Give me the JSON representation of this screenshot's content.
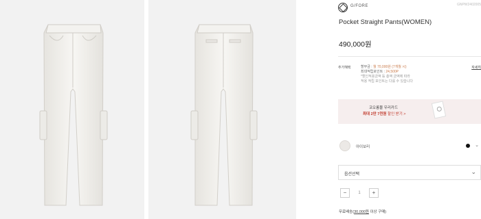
{
  "gallery": {
    "images": [
      {
        "alt": "front-view"
      },
      {
        "alt": "back-view"
      }
    ]
  },
  "brand": {
    "name": "G/FORE",
    "logo_icon": "gfore-logo-icon",
    "product_code": "GNPW2402005"
  },
  "product": {
    "title": "Pocket Straight Pants(WOMEN)",
    "price": "490,000원"
  },
  "benefits": {
    "label": "추가혜택",
    "line1_prefix": "할부금 :",
    "line1_highlight": "월 70,000원 (7개월 시)",
    "line2_prefix": "최대적립포인트 :",
    "line2_highlight": "24,500P",
    "note1": "*할인적용금액 등 총액 금액에 따라",
    "note2": "적용 적립 포인트는 다를 수 있습니다",
    "detail_link": "자세히"
  },
  "card_banner": {
    "line1": "코오롱몰 우리카드",
    "line2_prefix": "최대",
    "line2_highlight": "2만 7천원",
    "line2_suffix": "할인 받기 >"
  },
  "color": {
    "name": "아이보리",
    "swatch_color": "#ece9e6",
    "dot_color": "#111111",
    "arrow_icon": "chevron-down-icon"
  },
  "option": {
    "placeholder": "옵션선택",
    "chevron_icon": "chevron-down-icon"
  },
  "quantity": {
    "minus": "−",
    "value": "1",
    "plus": "+"
  },
  "shipping": {
    "prefix": "무료배송(",
    "price": "30,000원",
    "suffix": " 이상 구매)"
  }
}
